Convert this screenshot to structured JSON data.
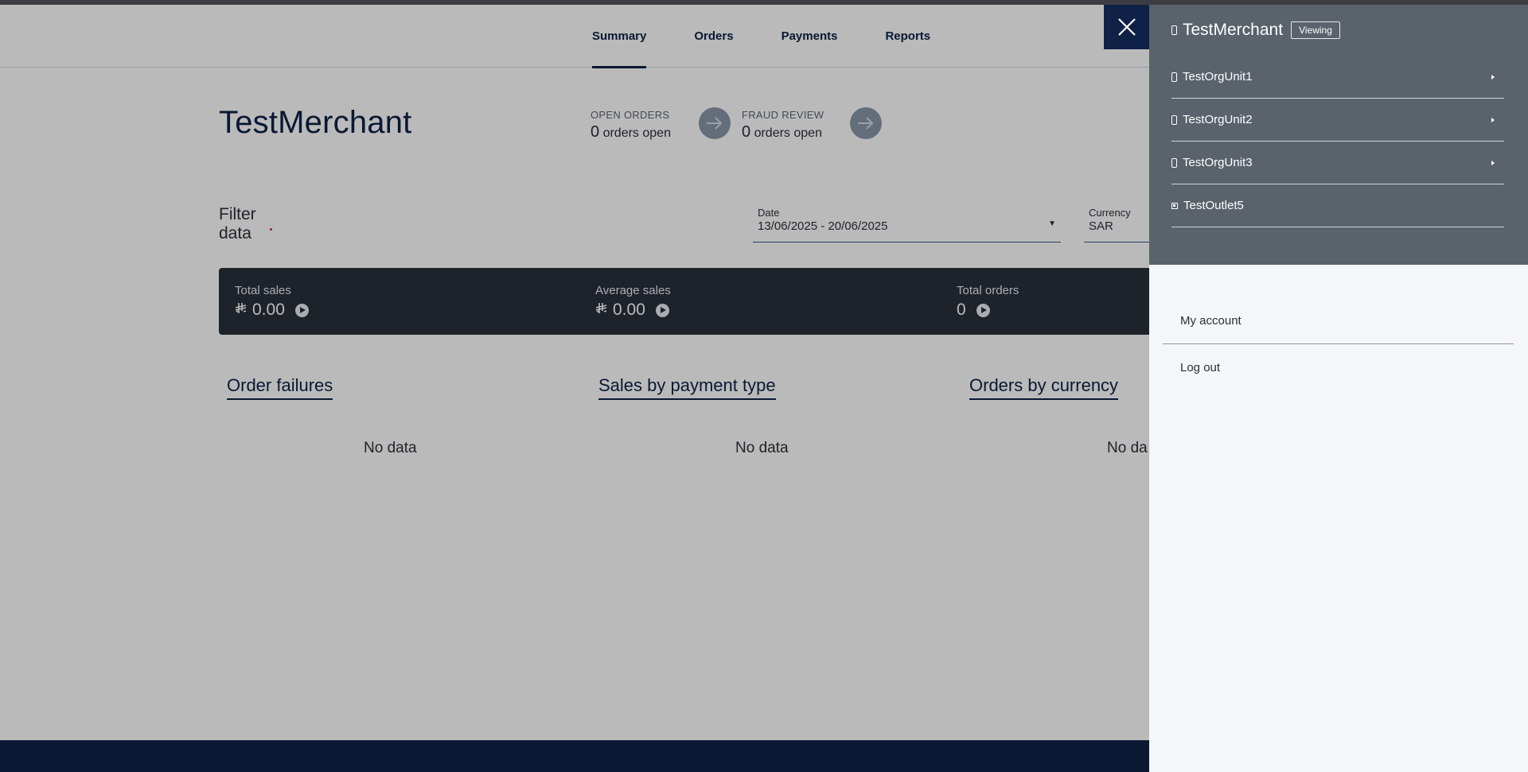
{
  "nav": {
    "tabs": [
      {
        "label": "Summary",
        "active": true
      },
      {
        "label": "Orders",
        "active": false
      },
      {
        "label": "Payments",
        "active": false
      },
      {
        "label": "Reports",
        "active": false
      }
    ]
  },
  "merchant": {
    "name": "TestMerchant"
  },
  "open_orders": {
    "label": "OPEN ORDERS",
    "count": "0",
    "suffix": "orders open"
  },
  "fraud_review": {
    "label": "FRAUD REVIEW",
    "count": "0",
    "suffix": "orders open"
  },
  "filter": {
    "label_line1": "Filter",
    "label_line2": "data",
    "date": {
      "label": "Date",
      "value": "13/06/2025 - 20/06/2025"
    },
    "currency": {
      "label": "Currency",
      "value": "SAR"
    }
  },
  "summary": {
    "currency_symbol": "⃁",
    "total_sales": {
      "label": "Total sales",
      "value": "0.00"
    },
    "average_sales": {
      "label": "Average sales",
      "value": "0.00"
    },
    "total_orders": {
      "label": "Total orders",
      "value": "0"
    }
  },
  "sections": [
    {
      "title": "Order failures",
      "empty": "No data"
    },
    {
      "title": "Sales by payment type",
      "empty": "No data"
    },
    {
      "title": "Orders by currency",
      "empty": "No da"
    }
  ],
  "drawer": {
    "current": {
      "name": "TestMerchant",
      "badge": "Viewing"
    },
    "org_units": [
      {
        "label": "TestOrgUnit1",
        "type": "unit"
      },
      {
        "label": "TestOrgUnit2",
        "type": "unit"
      },
      {
        "label": "TestOrgUnit3",
        "type": "unit"
      },
      {
        "label": "TestOutlet5",
        "type": "outlet"
      }
    ],
    "account": {
      "my_account": "My account",
      "log_out": "Log out"
    }
  },
  "colors": {
    "brand": "#0f2147",
    "summary_bar": "#2a313c",
    "drawer_top": "#5a626c",
    "drawer_bg": "#f4f6f9"
  }
}
